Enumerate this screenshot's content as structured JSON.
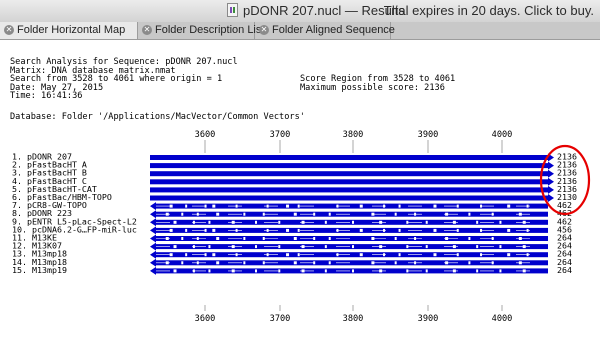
{
  "window": {
    "title": "pDONR 207.nucl — Results",
    "trial_notice": "Trial expires in 20 days. Click to buy."
  },
  "tabs": [
    {
      "label": "Folder Horizontal Map",
      "active": true
    },
    {
      "label": "Folder Description List",
      "active": false
    },
    {
      "label": "Folder Aligned Sequence",
      "active": false
    }
  ],
  "header": {
    "search_line": "Search Analysis for Sequence: pDONR 207.nucl",
    "matrix_line": "Matrix: DNA database matrix.nmat",
    "range_line": "Search from 3528 to 4061 where origin = 1",
    "date_line": "Date: May 27, 2015",
    "time_line": "Time: 16:41:36",
    "score_region_line": "Score Region from 3528 to 4061",
    "max_score_line": "Maximum possible score: 2136",
    "database_line": "Database: Folder '/Applications/MacVector/Common Vectors'"
  },
  "ruler": {
    "ticks": [
      "3600",
      "3700",
      "3800",
      "3900",
      "4000"
    ]
  },
  "colors": {
    "bar": "#0000cc",
    "highlight": "#e60000"
  },
  "hits": [
    {
      "label": "1. pDONR 207",
      "score": "2136",
      "pattern": "solid"
    },
    {
      "label": "2. pFastBacHT A",
      "score": "2136",
      "pattern": "solid"
    },
    {
      "label": "3. pFastBacHT B",
      "score": "2136",
      "pattern": "solid"
    },
    {
      "label": "4. pFastBacHT C",
      "score": "2136",
      "pattern": "solid"
    },
    {
      "label": "5. pFastBacHT-CAT",
      "score": "2136",
      "pattern": "solid"
    },
    {
      "label": "6. pFastBac/HBM-TOPO",
      "score": "2130",
      "pattern": "solid"
    },
    {
      "label": "7. pCR8-GW-TOPO",
      "score": "462",
      "pattern": "gapped"
    },
    {
      "label": "8. pDONR 223",
      "score": "462",
      "pattern": "gapped"
    },
    {
      "label": "9. pENTR L5-pLac-Spect-L2",
      "score": "462",
      "pattern": "gapped"
    },
    {
      "label": "10. pcDNA6.2-G…FP-miR-luc",
      "score": "456",
      "pattern": "gapped"
    },
    {
      "label": "11. M13KE",
      "score": "264",
      "pattern": "gapped"
    },
    {
      "label": "12. M13K07",
      "score": "264",
      "pattern": "gapped"
    },
    {
      "label": "13. M13mp18",
      "score": "264",
      "pattern": "gapped"
    },
    {
      "label": "14. M13mp18",
      "score": "264",
      "pattern": "gapped"
    },
    {
      "label": "15. M13mp19",
      "score": "264",
      "pattern": "gapped"
    }
  ]
}
